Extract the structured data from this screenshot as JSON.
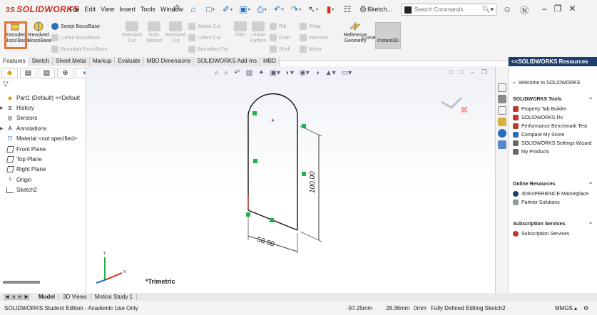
{
  "titlebar": {
    "logo_ds": "3S",
    "logo_text": "SOLIDWORKS",
    "menu": [
      "File",
      "Edit",
      "View",
      "Insert",
      "Tools",
      "Window"
    ],
    "sketch_dropdown": "Sketch...",
    "search_placeholder": "Search Commands"
  },
  "ribbon": {
    "extruded_boss": "Extruded Boss/Base",
    "revolved_boss": "Revolved Boss/Base",
    "swept_boss": "Swept Boss/Base",
    "lofted_boss": "Lofted Boss/Base",
    "boundary_boss": "Boundary Boss/Base",
    "extruded_cut": "Extruded Cut",
    "hole_wizard": "Hole Wizard",
    "revolved_cut": "Revolved Cut",
    "swept_cut": "Swept Cut",
    "lofted_cut": "Lofted Cut",
    "boundary_cut": "Boundary Cut",
    "fillet": "Fillet",
    "linear_pattern": "Linear Pattern",
    "rib": "Rib",
    "draft": "Draft",
    "shell": "Shell",
    "wrap": "Wrap",
    "intersect": "Intersect",
    "mirror": "Mirror",
    "reference_geometry": "Reference Geometry",
    "curves": "Curves",
    "instant3d": "Instant3D"
  },
  "cm_tabs": [
    "Features",
    "Sketch",
    "Sheet Metal",
    "Markup",
    "Evaluate",
    "MBD Dimensions",
    "SOLIDWORKS Add-Ins",
    "MBD"
  ],
  "tree": [
    {
      "label": "Part1 (Default) <<Default",
      "icon": "part-icon",
      "expandable": false
    },
    {
      "label": "History",
      "icon": "history-icon",
      "expandable": true
    },
    {
      "label": "Sensors",
      "icon": "sensors-icon",
      "expandable": false
    },
    {
      "label": "Annotations",
      "icon": "annotations-icon",
      "expandable": true
    },
    {
      "label": "Material <not specified>",
      "icon": "material-icon",
      "expandable": false
    },
    {
      "label": "Front Plane",
      "icon": "plane-icon",
      "expandable": false
    },
    {
      "label": "Top Plane",
      "icon": "plane-icon",
      "expandable": false
    },
    {
      "label": "Right Plane",
      "icon": "plane-icon",
      "expandable": false
    },
    {
      "label": "Origin",
      "icon": "origin-icon",
      "expandable": false
    },
    {
      "label": "Sketch2",
      "icon": "sketch-icon",
      "expandable": false
    }
  ],
  "sketch": {
    "dim_width": "50.00",
    "dim_height": "100.00",
    "view_label": "*Trimetric"
  },
  "task_pane": {
    "header": "<<SOLIDWORKS Resources",
    "welcome": "Welcome to SOLIDWORKS",
    "sections": [
      {
        "title": "SOLIDWORKS Tools",
        "links": [
          "Property Tab Builder",
          "SOLIDWORKS Rx",
          "Performance Benchmark Test",
          "Compare My Score",
          "SOLIDWORKS Settings Wizard",
          "My Products"
        ]
      },
      {
        "title": "Online Resources",
        "links": [
          "3DEXPERIENCE Marketplace",
          "Partner Solutions"
        ]
      },
      {
        "title": "Subscription Services",
        "links": [
          "Subscription Services"
        ]
      }
    ]
  },
  "model_tabs": [
    "Model",
    "3D Views",
    "Motion Study 1"
  ],
  "status": {
    "edition": "SOLIDWORKS Student Edition - Academic Use Only",
    "x": "-97.25mm",
    "y": "28.36mm",
    "z": "0mm",
    "state": "Fully Defined",
    "editing": "Editing Sketch2",
    "units": "MMGS"
  },
  "colors": {
    "accent_orange": "#e07335",
    "brand_red": "#d62718",
    "sketch_green": "#22b14c",
    "task_header": "#1d3f6e"
  }
}
